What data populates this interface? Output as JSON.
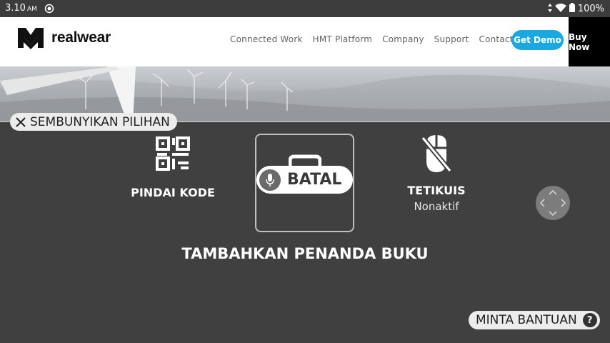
{
  "status_bar": {
    "time": "3.10",
    "ampm": "AM",
    "battery": "100%"
  },
  "site": {
    "logo_text": "realwear",
    "nav": [
      "Connected Work",
      "HMT Platform",
      "Company",
      "Support",
      "Contact"
    ],
    "demo_label": "Get Demo",
    "buy_label": "Buy Now"
  },
  "overlay": {
    "hide_options": "SEMBUNYIKAN PILIHAN",
    "scan_code": "PINDAI KODE",
    "cancel": "BATAL",
    "mouse": "TETIKUIS",
    "mouse_state": "Nonaktif",
    "add_bookmark": "TAMBAHKAN PENANDA BUKU",
    "get_help": "MINTA BANTUAN",
    "help_glyph": "?"
  },
  "colors": {
    "accent": "#1ba8e0",
    "overlay_bg": "#404040"
  }
}
